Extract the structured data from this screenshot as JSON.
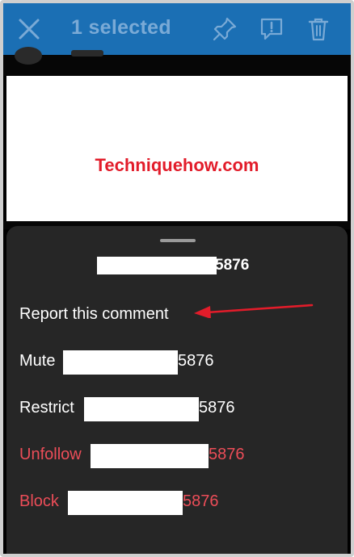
{
  "topbar": {
    "title": "1 selected",
    "icons": [
      "close-icon",
      "pin-icon",
      "report-icon",
      "trash-icon"
    ],
    "color": "#1b6fb4"
  },
  "post": {
    "watermark": "Techniquehow.com",
    "watermark_color": "#e21c2a"
  },
  "sheet": {
    "title_suffix": "5876",
    "items": [
      {
        "label": "Report this comment",
        "suffix": "",
        "danger": false
      },
      {
        "label": "Mute",
        "suffix": "5876",
        "danger": false
      },
      {
        "label": "Restrict",
        "suffix": "5876",
        "danger": false
      },
      {
        "label": "Unfollow",
        "suffix": "5876",
        "danger": true
      },
      {
        "label": "Block",
        "suffix": "5876",
        "danger": true
      }
    ],
    "danger_color": "#ec4d58",
    "background": "#262626"
  },
  "annotation": {
    "arrow_color": "#e21c2a"
  }
}
